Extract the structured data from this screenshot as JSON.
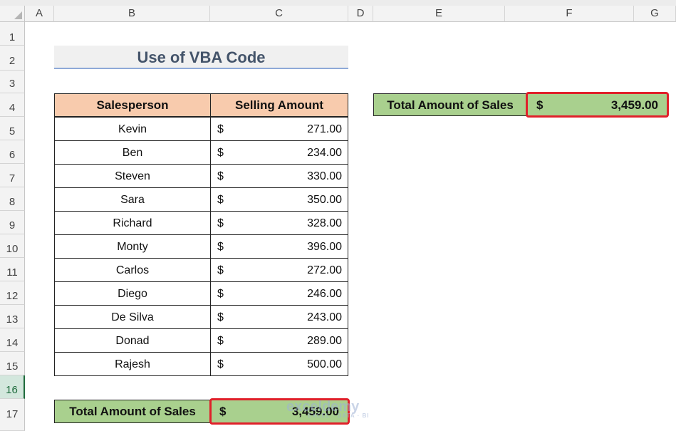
{
  "columns": [
    "A",
    "B",
    "C",
    "D",
    "E",
    "F",
    "G"
  ],
  "rows": [
    "1",
    "2",
    "3",
    "4",
    "5",
    "6",
    "7",
    "8",
    "9",
    "10",
    "11",
    "12",
    "13",
    "14",
    "15",
    "16",
    "17"
  ],
  "title": "Use of VBA Code",
  "table": {
    "headers": [
      "Salesperson",
      "Selling Amount"
    ],
    "rows": [
      {
        "name": "Kevin",
        "currency": "$",
        "amount": "271.00"
      },
      {
        "name": "Ben",
        "currency": "$",
        "amount": "234.00"
      },
      {
        "name": "Steven",
        "currency": "$",
        "amount": "330.00"
      },
      {
        "name": "Sara",
        "currency": "$",
        "amount": "350.00"
      },
      {
        "name": "Richard",
        "currency": "$",
        "amount": "328.00"
      },
      {
        "name": "Monty",
        "currency": "$",
        "amount": "396.00"
      },
      {
        "name": "Carlos",
        "currency": "$",
        "amount": "272.00"
      },
      {
        "name": "Diego",
        "currency": "$",
        "amount": "246.00"
      },
      {
        "name": "De Silva",
        "currency": "$",
        "amount": "243.00"
      },
      {
        "name": "Donad",
        "currency": "$",
        "amount": "289.00"
      },
      {
        "name": "Rajesh",
        "currency": "$",
        "amount": "500.00"
      }
    ]
  },
  "bottom_total": {
    "label": "Total Amount of Sales",
    "currency": "$",
    "amount": "3,459.00"
  },
  "side_total": {
    "label": "Total Amount of Sales",
    "currency": "$",
    "amount": "3,459.00"
  },
  "watermark": {
    "brand": "exceldemy",
    "tagline": "EXCEL · DATA · BI"
  },
  "colors": {
    "header_fill": "#f8cbad",
    "total_fill": "#a9d08e",
    "highlight": "#e0202a",
    "title_text": "#44546a"
  },
  "selected_row": "16"
}
